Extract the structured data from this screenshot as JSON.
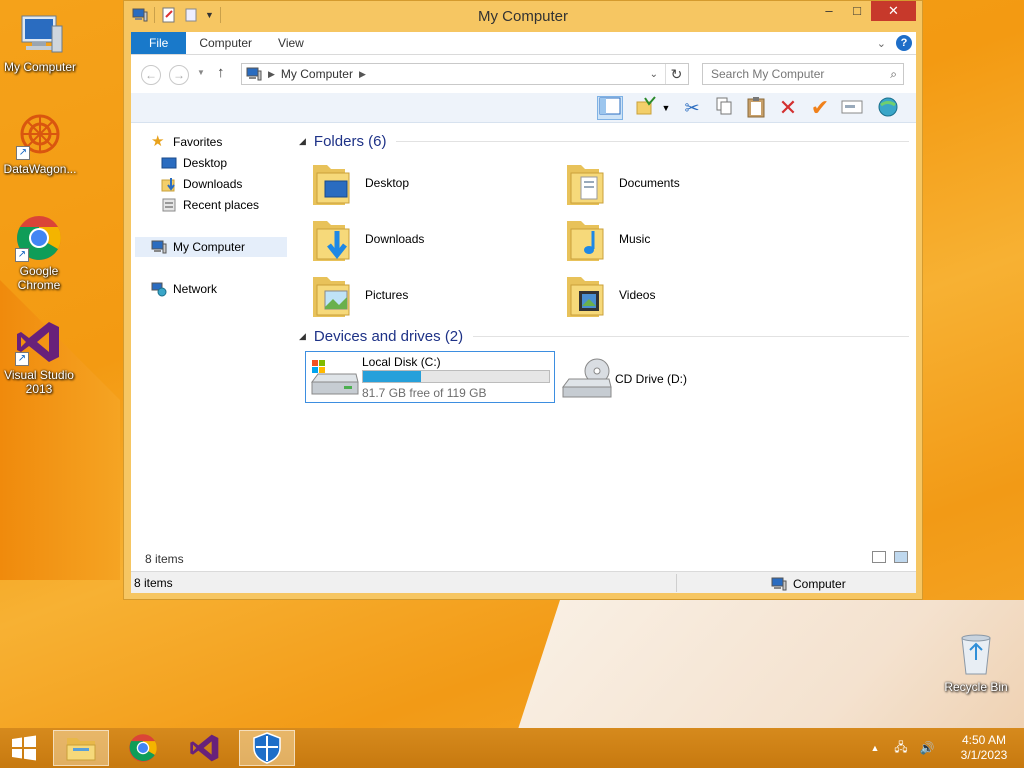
{
  "desktop": {
    "icons": [
      {
        "label": "My Computer",
        "icon": "computer-icon"
      },
      {
        "label": "DataWagon...",
        "icon": "datawagon-icon"
      },
      {
        "label": "Google Chrome",
        "icon": "chrome-icon"
      },
      {
        "label": "Visual Studio 2013",
        "icon": "visual-studio-icon"
      },
      {
        "label": "Recycle Bin",
        "icon": "recycle-bin-icon"
      }
    ]
  },
  "window": {
    "title": "My Computer",
    "controls": {
      "minimize": "–",
      "maximize": "□",
      "close": "✕"
    },
    "tabs": {
      "file": "File",
      "computer": "Computer",
      "view": "View"
    },
    "address": {
      "location": "My Computer",
      "search_placeholder": "Search My Computer"
    },
    "nav": {
      "favorites": "Favorites",
      "desktop": "Desktop",
      "downloads": "Downloads",
      "recent": "Recent places",
      "my_computer": "My Computer",
      "network": "Network"
    },
    "folders_header": "Folders (6)",
    "folders": [
      {
        "name": "Desktop"
      },
      {
        "name": "Documents"
      },
      {
        "name": "Downloads"
      },
      {
        "name": "Music"
      },
      {
        "name": "Pictures"
      },
      {
        "name": "Videos"
      }
    ],
    "drives_header": "Devices and drives (2)",
    "drives": {
      "c": {
        "name": "Local Disk (C:)",
        "free_text": "81.7 GB free of 119 GB",
        "used_fraction": 0.313
      },
      "d": {
        "name": "CD Drive (D:)"
      }
    },
    "content_status": "8 items",
    "status": {
      "left": "8 items",
      "right": "Computer"
    }
  },
  "taskbar": {
    "clock_time": "4:50 AM",
    "clock_date": "3/1/2023"
  },
  "colors": {
    "accent": "#1979ca",
    "window_frame": "#f6c662",
    "progress": "#26a0da",
    "close": "#c7392b",
    "group_header": "#1e3287"
  }
}
